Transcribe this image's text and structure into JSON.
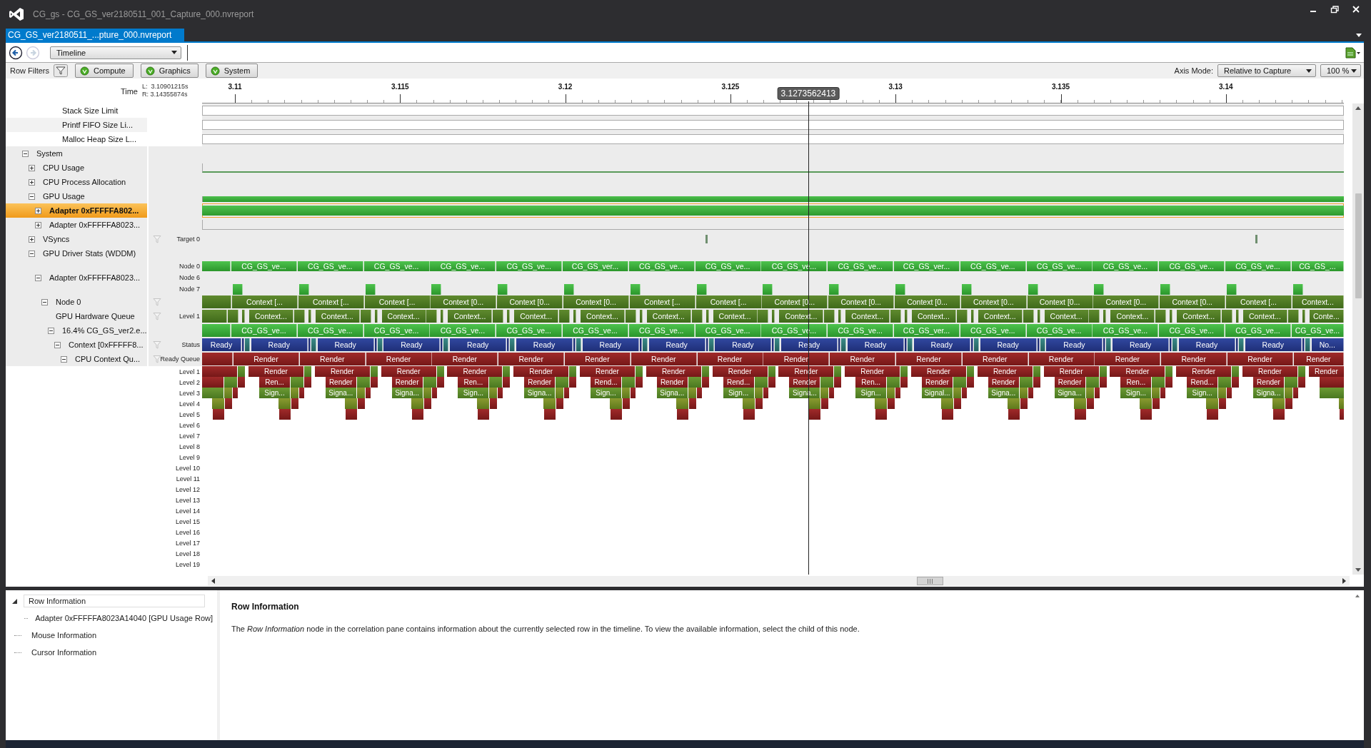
{
  "window": {
    "title": "CG_gs - CG_GS_ver2180511_001_Capture_000.nvreport"
  },
  "tabs": [
    {
      "label": "CG_GS_ver2180511_...pture_000.nvreport",
      "selected": true
    }
  ],
  "navigation": [
    {
      "kind": "back",
      "disabled": false
    },
    {
      "kind": "forward",
      "disabled": true
    }
  ],
  "view_selector": {
    "value": "Timeline"
  },
  "row_filters": {
    "label": "Row Filters",
    "buttons": [
      {
        "label": "Compute",
        "on": true
      },
      {
        "label": "Graphics",
        "on": true
      },
      {
        "label": "System",
        "on": true
      }
    ]
  },
  "axis_mode": {
    "label": "Axis Mode:",
    "value": "Relative to Capture"
  },
  "zoom": {
    "value": "100 %"
  },
  "time_header": {
    "label": "Time",
    "left": "L:  3.10901215s",
    "right": "R: 3.14355874s"
  },
  "axis_ticks": [
    "3.11",
    "3.115",
    "3.12",
    "3.125",
    "3.13",
    "3.135",
    "3.14"
  ],
  "cursor": "3.1273562413",
  "limit_rows": [
    {
      "label": "Stack Size Limit",
      "selected": false,
      "lanes": [
        {
          "kind": "limit"
        }
      ]
    },
    {
      "label": "Printf FIFO Size Li...",
      "selected": false,
      "lanes": [
        {
          "kind": "limit"
        }
      ]
    },
    {
      "label": "Malloc Heap Size L...",
      "selected": false,
      "lanes": [
        {
          "kind": "limit"
        }
      ]
    }
  ],
  "rows": [
    {
      "label": "System",
      "expanded": true,
      "selected": false,
      "filter": false,
      "children": [
        {
          "label": "CPU Usage",
          "expanded": false,
          "selected": false,
          "filter": false,
          "lanes": [
            {
              "kind": "cpu_line"
            }
          ]
        },
        {
          "label": "CPU Process Allocation",
          "expanded": false,
          "selected": false,
          "filter": false
        },
        {
          "label": "GPU Usage",
          "expanded": true,
          "selected": false,
          "filter": false,
          "lanes": [
            {
              "kind": "gpu_thin"
            }
          ],
          "children": [
            {
              "label": "Adapter 0xFFFFFA802...",
              "expanded": false,
              "selected": true,
              "filter": false,
              "lanes": [
                {
                  "kind": "gpu_full"
                }
              ]
            },
            {
              "label": "Adapter 0xFFFFFA8023...",
              "expanded": false,
              "selected": false,
              "filter": false,
              "lanes": [
                {
                  "kind": "empty_line"
                }
              ]
            }
          ]
        },
        {
          "label": "VSyncs",
          "expanded": false,
          "selected": false,
          "filter": true,
          "lanes": [
            {
              "kind": "vsync",
              "label": "Target 0"
            }
          ]
        },
        {
          "label": "GPU Driver Stats (WDDM)",
          "expanded": true,
          "selected": false,
          "filter": false,
          "children": [
            {
              "label": "Adapter 0xFFFFFA8023...",
              "expanded": true,
              "selected": false,
              "filter": false,
              "lanes": [
                {
                  "kind": "node_bar",
                  "label": "Node 0",
                  "labels": [
                    "CG_GS_ve...",
                    "CG_GS_ve...",
                    "CG_GS_ve...",
                    "CG_GS_ve...",
                    "CG_GS_ve...",
                    "CG_GS_ver...",
                    "CG_GS_ve...",
                    "CG_GS_ve...",
                    "CG_GS_ve...",
                    "CG_GS_ve...",
                    "CG_GS_ver...",
                    "CG_GS_ve...",
                    "CG_GS_ve...",
                    "CG_GS_ve...",
                    "CG_GS_ve...",
                    "CG_GS_ve...",
                    "CG_GS_..."
                  ]
                },
                {
                  "kind": "node_empty",
                  "label": "Node 6"
                },
                {
                  "kind": "node_blocks",
                  "label": "Node 7"
                }
              ],
              "children": [
                {
                  "label": "Node 0",
                  "expanded": true,
                  "selected": false,
                  "filter": true,
                  "lanes": [
                    {
                      "kind": "context",
                      "labels": [
                        "Context [...",
                        "Context [...",
                        "Context [...",
                        "Context [0...",
                        "Context [0...",
                        "Context [0...",
                        "Context [...",
                        "Context [...",
                        "Context [0...",
                        "Context [0...",
                        "Context [0...",
                        "Context [0...",
                        "Context [0...",
                        "Context [0...",
                        "Context [0...",
                        "Context [...",
                        "Context..."
                      ]
                    }
                  ],
                  "children": [
                    {
                      "label": "GPU Hardware Queue",
                      "selected": false,
                      "filter": true,
                      "lanes": [
                        {
                          "kind": "hwq",
                          "label": "Level 1",
                          "labels": [
                            "Context...",
                            "Context...",
                            "Context...",
                            "Context...",
                            "Context...",
                            "Context...",
                            "Context...",
                            "Context...",
                            "Context...",
                            "Context...",
                            "Context...",
                            "Context...",
                            "Context...",
                            "Context...",
                            "Context...",
                            "Context...",
                            "Conte..."
                          ]
                        }
                      ]
                    },
                    {
                      "label": "16.4% CG_GS_ver2.e...",
                      "expanded": true,
                      "selected": false,
                      "filter": false,
                      "lanes": [
                        {
                          "kind": "process",
                          "labels": [
                            "CG_GS_ve...",
                            "CG_GS_ve...",
                            "CG_GS_ve...",
                            "CG_GS_ve...",
                            "CG_GS_ve...",
                            "CG_GS_ve...",
                            "CG_GS_ve...",
                            "CG_GS_ve...",
                            "CG_GS_ve...",
                            "CG_GS_ve...",
                            "CG_GS_ver...",
                            "CG_GS_ve...",
                            "CG_GS_ve...",
                            "CG_GS_ve...",
                            "CG_GS_ve...",
                            "CG_GS_ve...",
                            "CG_GS_ve..."
                          ]
                        }
                      ],
                      "children": [
                        {
                          "label": "Context [0xFFFFF8...",
                          "expanded": true,
                          "selected": false,
                          "filter": true,
                          "lanes": [
                            {
                              "kind": "status",
                              "label": "Status",
                              "labels": [
                                "Ready",
                                "Ready",
                                "Ready",
                                "Ready",
                                "Ready",
                                "Ready",
                                "Ready",
                                "Ready",
                                "Ready",
                                "Ready",
                                "Ready",
                                "Ready",
                                "Ready",
                                "Ready",
                                "Ready",
                                "Ready",
                                "Ready",
                                "No..."
                              ]
                            }
                          ],
                          "children": [
                            {
                              "label": "CPU Context Qu...",
                              "expanded": true,
                              "selected": false,
                              "filter": true,
                              "lanes": [
                                {
                                  "kind": "render",
                                  "label": "Ready Queue",
                                  "labels": [
                                    "Render",
                                    "Render",
                                    "Render",
                                    "Render",
                                    "Render",
                                    "Render",
                                    "Render",
                                    "Render",
                                    "Render",
                                    "Render",
                                    "Render",
                                    "Render",
                                    "Render",
                                    "Render",
                                    "Render",
                                    "Render",
                                    "Render"
                                  ]
                                }
                              ],
                              "queue_levels": [
                                {
                                  "kind": "level1",
                                  "label": "Level 1",
                                  "labels": [
                                    "Render",
                                    "Render",
                                    "Render",
                                    "Render",
                                    "Render",
                                    "Render",
                                    "Render",
                                    "Render",
                                    "Render",
                                    "Render",
                                    "Render",
                                    "Render",
                                    "Render",
                                    "Render",
                                    "Render",
                                    "Render",
                                    "Render"
                                  ]
                                },
                                {
                                  "kind": "level2",
                                  "label": "Level 2",
                                  "labels": [
                                    "Ren...",
                                    "Render",
                                    "Render",
                                    "Ren...",
                                    "Render",
                                    "Rend...",
                                    "Render",
                                    "Rend...",
                                    "Render",
                                    "Ren...",
                                    "Render",
                                    "Render",
                                    "Render",
                                    "Ren...",
                                    "Rend...",
                                    "Render"
                                  ]
                                },
                                {
                                  "kind": "level3",
                                  "label": "Level 3",
                                  "labels": [
                                    "Sign...",
                                    "Signa...",
                                    "Signa...",
                                    "Sign...",
                                    "Signa...",
                                    "Sign...",
                                    "Signa...",
                                    "Sign...",
                                    "Signa...",
                                    "Sign...",
                                    "Signal...",
                                    "Signa...",
                                    "Signa...",
                                    "Sign...",
                                    "Sign...",
                                    "Signa..."
                                  ]
                                },
                                {
                                  "kind": "level4",
                                  "label": "Level 4"
                                },
                                {
                                  "kind": "level5",
                                  "label": "Level 5"
                                },
                                {
                                  "kind": "empty",
                                  "label": "Level 6"
                                },
                                {
                                  "kind": "empty",
                                  "label": "Level 7"
                                },
                                {
                                  "kind": "empty",
                                  "label": "Level 8"
                                },
                                {
                                  "kind": "empty",
                                  "label": "Level 9"
                                },
                                {
                                  "kind": "empty",
                                  "label": "Level 10"
                                },
                                {
                                  "kind": "empty",
                                  "label": "Level 11"
                                },
                                {
                                  "kind": "empty",
                                  "label": "Level 12"
                                },
                                {
                                  "kind": "empty",
                                  "label": "Level 13"
                                },
                                {
                                  "kind": "empty",
                                  "label": "Level 14"
                                },
                                {
                                  "kind": "empty",
                                  "label": "Level 15"
                                },
                                {
                                  "kind": "empty",
                                  "label": "Level 16"
                                },
                                {
                                  "kind": "empty",
                                  "label": "Level 17"
                                },
                                {
                                  "kind": "empty",
                                  "label": "Level 18"
                                },
                                {
                                  "kind": "empty",
                                  "label": "Level 19"
                                }
                              ]
                            }
                          ]
                        }
                      ]
                    }
                  ]
                }
              ]
            }
          ]
        }
      ]
    }
  ],
  "correlation_tree": [
    {
      "label": "Row Information",
      "expanded": true,
      "selected": true,
      "children": [
        {
          "label": "Adapter 0xFFFFFA8023A14040 [GPU Usage Row]",
          "selected": false
        }
      ]
    },
    {
      "label": "Mouse Information",
      "selected": false
    },
    {
      "label": "Cursor Information",
      "selected": false
    }
  ],
  "detail": {
    "title": "Row Information",
    "text": "The *Row Information* node in the correlation pane contains information about the currently selected row in the timeline. To view the available information, select the child of this node."
  }
}
